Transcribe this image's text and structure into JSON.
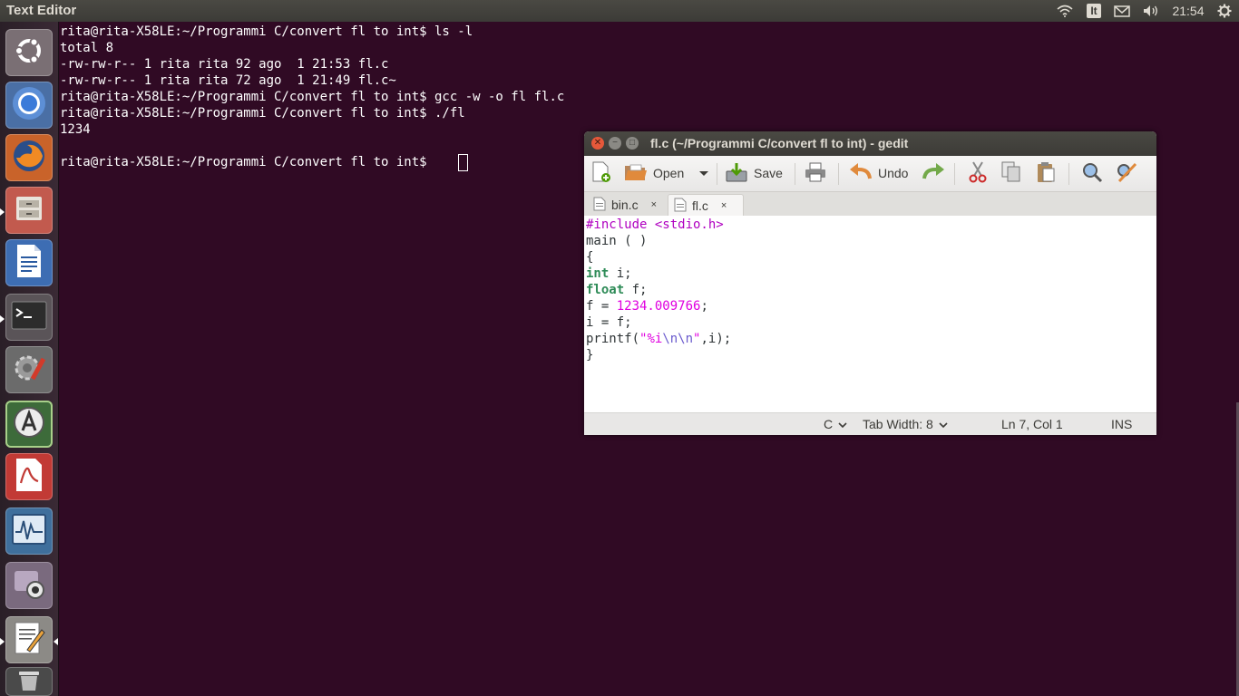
{
  "topbar": {
    "app_title": "Text Editor",
    "keyboard_layout": "It",
    "clock": "21:54",
    "icons": [
      "wifi-icon",
      "keyboard-layout-indicator",
      "mail-icon",
      "volume-icon",
      "gear-icon"
    ]
  },
  "launcher": {
    "items": [
      {
        "name": "dash-home",
        "icon": "ubuntu-logo-icon"
      },
      {
        "name": "chromium",
        "icon": "chromium-icon"
      },
      {
        "name": "firefox",
        "icon": "firefox-icon"
      },
      {
        "name": "files",
        "icon": "file-cabinet-icon"
      },
      {
        "name": "libreoffice-writer",
        "icon": "writer-document-icon"
      },
      {
        "name": "terminal",
        "icon": "terminal-icon"
      },
      {
        "name": "system-settings",
        "icon": "settings-tools-icon"
      },
      {
        "name": "software-updater",
        "icon": "software-updater-icon"
      },
      {
        "name": "document-viewer",
        "icon": "pdf-viewer-icon"
      },
      {
        "name": "system-monitor",
        "icon": "system-monitor-icon"
      },
      {
        "name": "webcam-app",
        "icon": "webcam-icon"
      },
      {
        "name": "text-editor",
        "icon": "text-editor-icon"
      },
      {
        "name": "trash",
        "icon": "trash-icon"
      }
    ]
  },
  "terminal": {
    "lines": [
      "rita@rita-X58LE:~/Programmi C/convert fl to int$ ls -l",
      "total 8",
      "-rw-rw-r-- 1 rita rita 92 ago  1 21:53 fl.c",
      "-rw-rw-r-- 1 rita rita 72 ago  1 21:49 fl.c~",
      "rita@rita-X58LE:~/Programmi C/convert fl to int$ gcc -w -o fl fl.c",
      "rita@rita-X58LE:~/Programmi C/convert fl to int$ ./fl",
      "1234",
      "",
      "rita@rita-X58LE:~/Programmi C/convert fl to int$ "
    ]
  },
  "gedit": {
    "title": "fl.c (~/Programmi C/convert fl to int) - gedit",
    "toolbar": {
      "open_label": "Open",
      "save_label": "Save",
      "undo_label": "Undo"
    },
    "tabs": [
      {
        "label": "bin.c",
        "close": "×"
      },
      {
        "label": "fl.c",
        "close": "×"
      }
    ],
    "code": {
      "l1_pp": "#include <stdio.h>",
      "l2": "main ( )",
      "l3": "{",
      "l4_kw": "int",
      "l4_rest": " i;",
      "l5_kw": "float",
      "l5_rest": " f;",
      "l6_a": "f = ",
      "l6_num": "1234.009766",
      "l6_b": ";",
      "l7": "i = f;",
      "l8_a": "printf(",
      "l8_q1": "\"%i",
      "l8_esc": "\\n\\n",
      "l8_q2": "\"",
      "l8_b": ",i);",
      "l9": "}"
    },
    "status": {
      "language": "C",
      "tab_width": "Tab Width: 8",
      "position": "Ln 7, Col 1",
      "mode": "INS"
    }
  },
  "colors": {
    "desktop_bg": "#300a24",
    "panel_bg": "#3c3b37",
    "keyword": "#2e8b57",
    "preprocessor": "#b000c0",
    "number": "#e000e0"
  }
}
